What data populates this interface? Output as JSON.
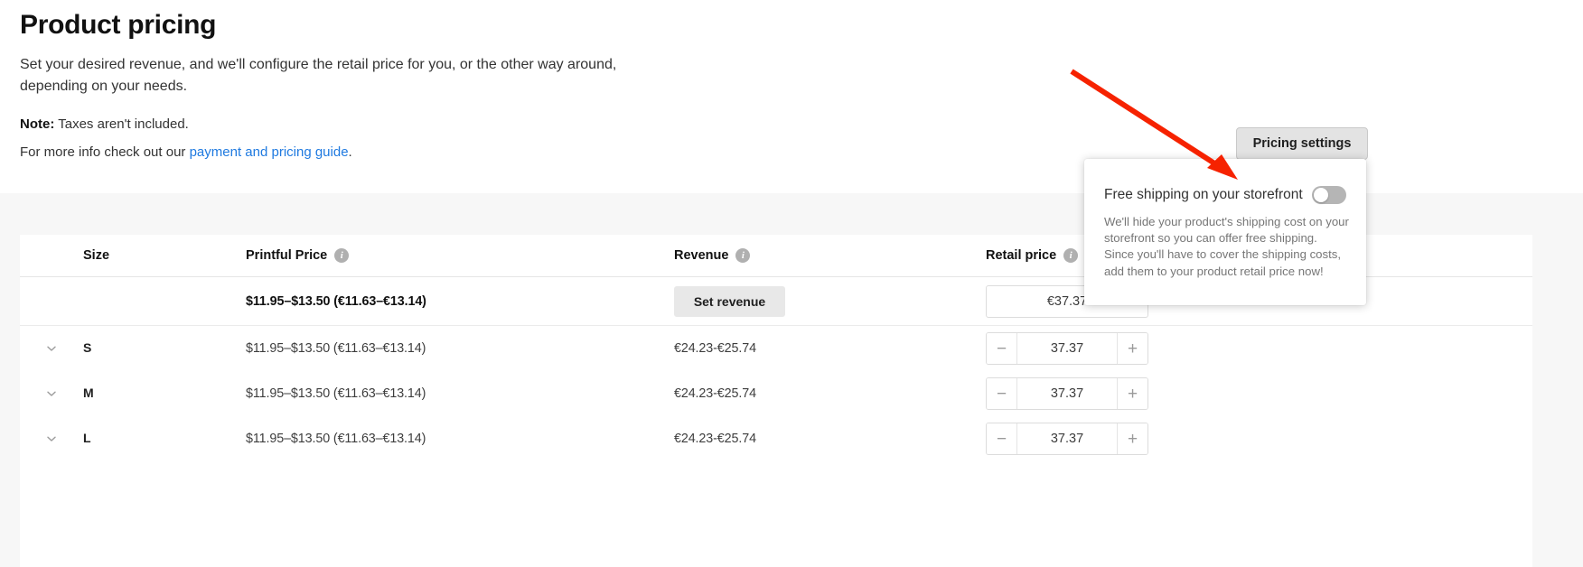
{
  "page": {
    "title": "Product pricing",
    "intro": "Set your desired revenue, and we'll configure the retail price for you, or the other way around, depending on your needs.",
    "note_label": "Note:",
    "note_text": " Taxes aren't included.",
    "more_info_prefix": "For more info check out our ",
    "more_info_link": "payment and pricing guide",
    "more_info_suffix": "."
  },
  "toolbar": {
    "pricing_settings_label": "Pricing settings"
  },
  "popover": {
    "title": "Free shipping on your storefront",
    "body": "We'll hide your product's shipping cost on your storefront so you can offer free shipping. Since you'll have to cover the shipping costs, add them to your product retail price now!",
    "toggle_state": "off"
  },
  "table": {
    "headers": {
      "size": "Size",
      "printful_price": "Printful Price",
      "revenue": "Revenue",
      "retail_price": "Retail price",
      "info_glyph": "i"
    },
    "summary": {
      "printful_price": "$11.95–$13.50 (€11.63–€13.14)",
      "set_revenue_label": "Set revenue",
      "retail_price_value": "€37.37"
    },
    "stepper": {
      "minus_label": "−",
      "plus_label": "+"
    },
    "rows": [
      {
        "size": "S",
        "printful_price": "$11.95–$13.50 (€11.63–€13.14)",
        "revenue": "€24.23-€25.74",
        "retail_price": "37.37"
      },
      {
        "size": "M",
        "printful_price": "$11.95–$13.50 (€11.63–€13.14)",
        "revenue": "€24.23-€25.74",
        "retail_price": "37.37"
      },
      {
        "size": "L",
        "printful_price": "$11.95–$13.50 (€11.63–€13.14)",
        "revenue": "€24.23-€25.74",
        "retail_price": "37.37"
      }
    ]
  },
  "annotation": {
    "arrow_color": "#F62200"
  }
}
